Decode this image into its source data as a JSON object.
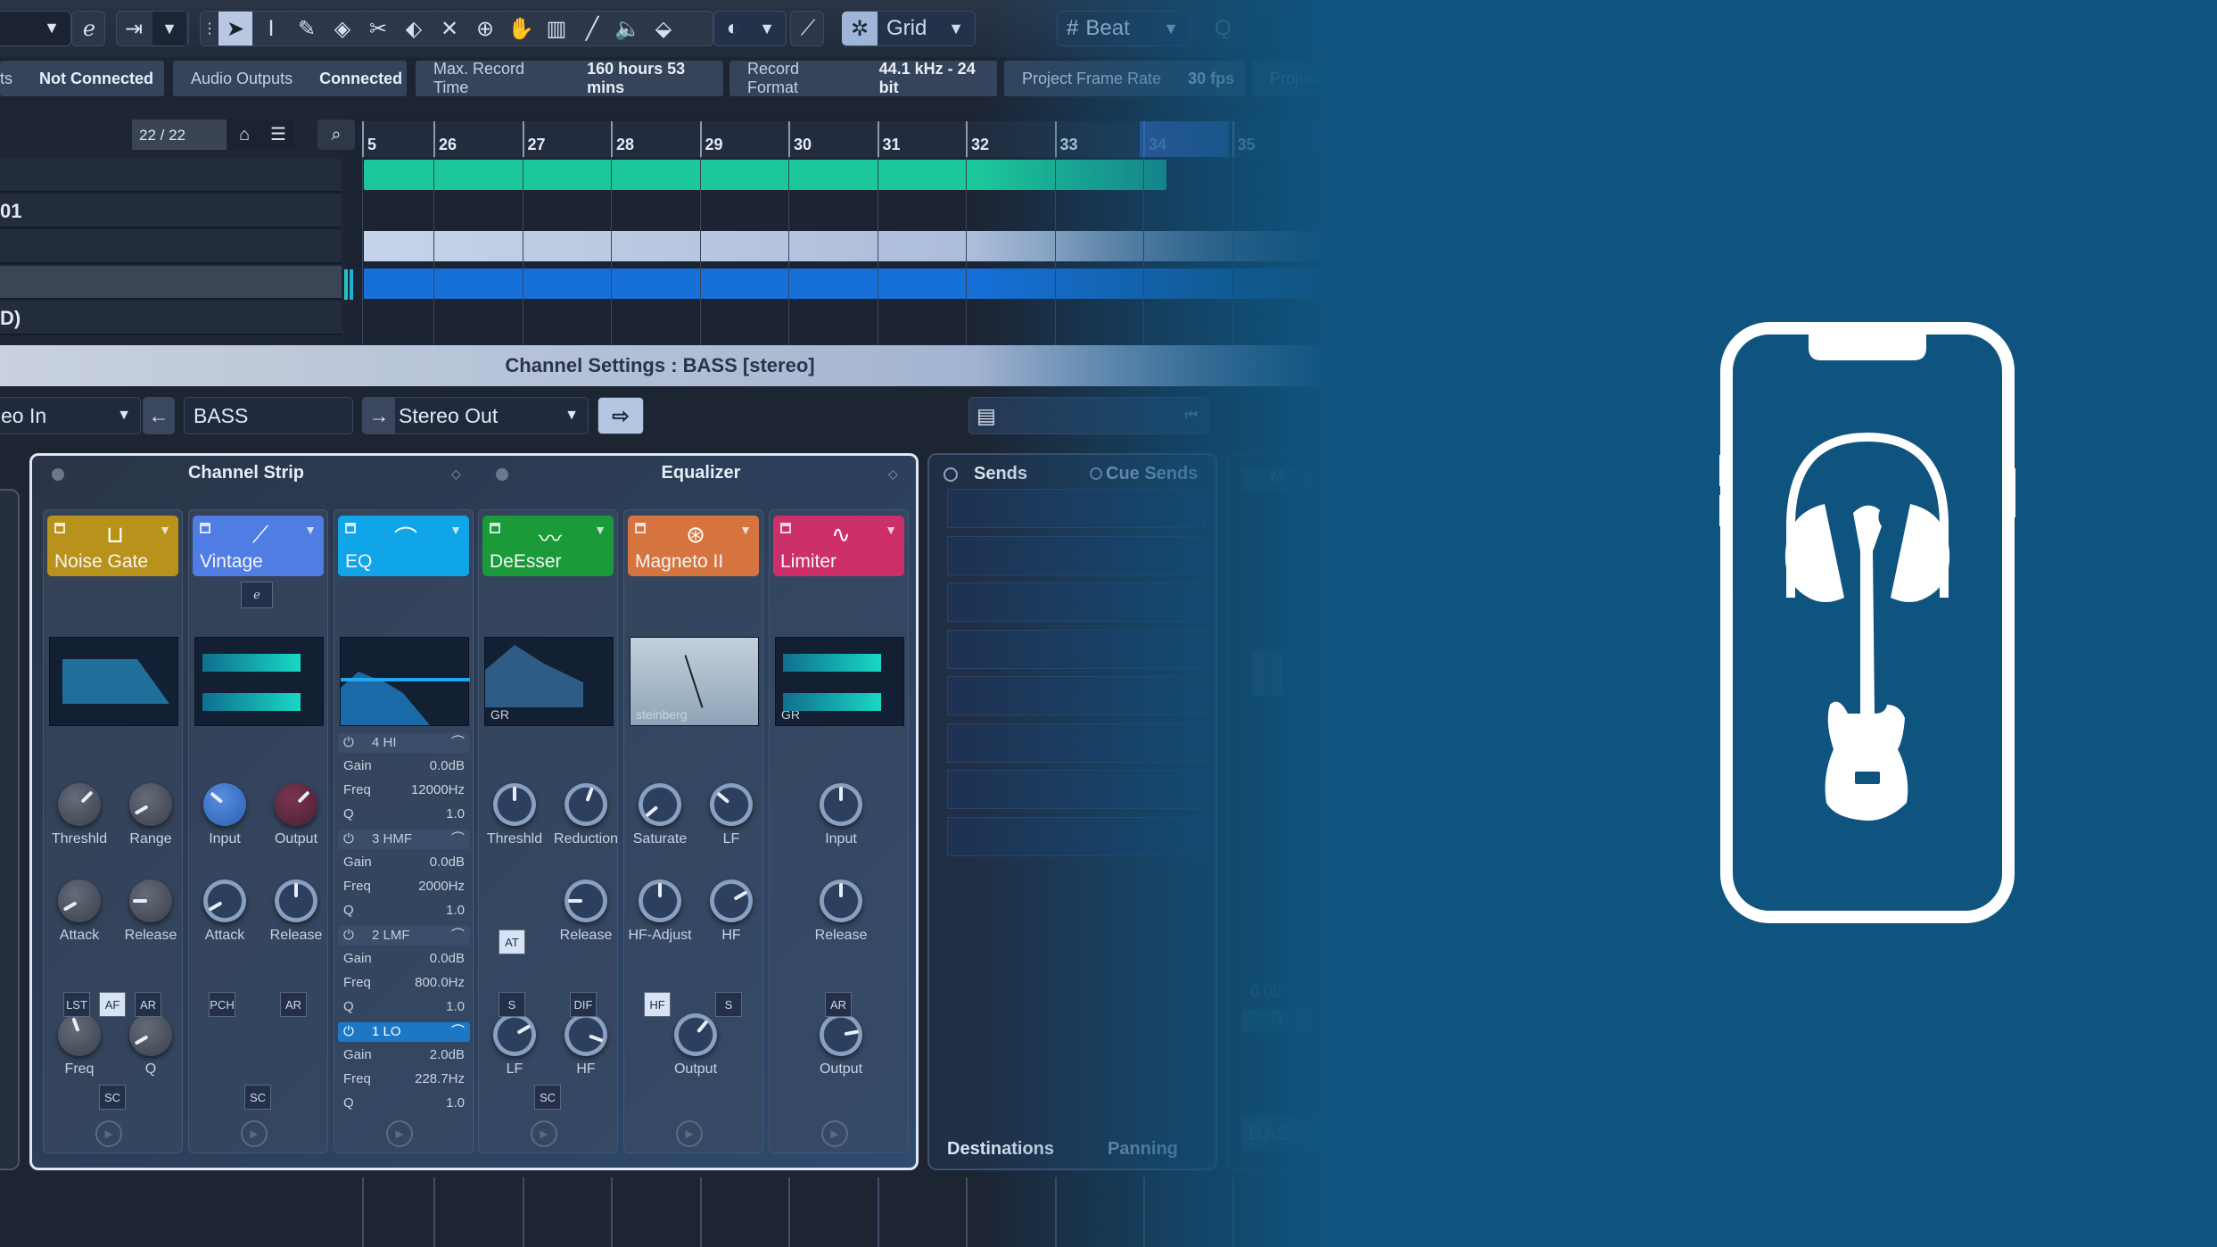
{
  "toolbar": {
    "snap_type": "Grid",
    "quantize_type": "Beat",
    "tools": [
      "object-selection",
      "range-selection",
      "draw",
      "erase",
      "split",
      "glue",
      "mute",
      "zoom",
      "play",
      "comp",
      "line",
      "speaker",
      "color"
    ]
  },
  "status": [
    {
      "key": "ts",
      "value": "Not Connected"
    },
    {
      "key": "Audio Outputs",
      "value": "Connected"
    },
    {
      "key": "Max. Record Time",
      "value": "160 hours 53 mins"
    },
    {
      "key": "Record Format",
      "value": "44.1 kHz - 24 bit"
    },
    {
      "key": "Project Frame Rate",
      "value": "30 fps"
    },
    {
      "key": "Project P",
      "value": ""
    }
  ],
  "tracklist": {
    "counter": "22 / 22",
    "tracks": [
      "",
      "01",
      "",
      "",
      "D)"
    ]
  },
  "ruler": [
    "5",
    "26",
    "27",
    "28",
    "29",
    "30",
    "31",
    "32",
    "33",
    "34",
    "35"
  ],
  "channel": {
    "title": "Channel Settings : BASS [stereo]",
    "input": "eo In",
    "name": "BASS",
    "output": "Stereo Out"
  },
  "strip": {
    "tab_channel_strip": "Channel Strip",
    "tab_equalizer": "Equalizer",
    "modules": [
      {
        "name": "Noise Gate",
        "color": "#b8921b",
        "knobs": [
          {
            "label": "Threshld",
            "rot": 45
          },
          {
            "label": "Range",
            "rot": -120
          },
          {
            "label": "Attack",
            "rot": -120
          },
          {
            "label": "Release",
            "rot": -90
          },
          {
            "label": "Freq",
            "rot": -20
          },
          {
            "label": "Q",
            "rot": -120
          }
        ],
        "buttons": [
          "LST",
          "AF",
          "AR"
        ],
        "active_button": "AF",
        "sc": "SC"
      },
      {
        "name": "Vintage",
        "color": "#4f7de3",
        "knobs": [
          {
            "label": "Input",
            "rot": -50
          },
          {
            "label": "Output",
            "rot": 45
          },
          {
            "label": "Attack",
            "rot": -120
          },
          {
            "label": "Release",
            "rot": 0
          }
        ],
        "buttons": [
          "PCH",
          "AR"
        ],
        "sc": "SC"
      },
      {
        "name": "EQ",
        "color": "#10a4e8",
        "bands": [
          {
            "name": "4 HI",
            "gain": "0.0dB",
            "freq": "12000Hz",
            "q": "1.0"
          },
          {
            "name": "3 HMF",
            "gain": "0.0dB",
            "freq": "2000Hz",
            "q": "1.0"
          },
          {
            "name": "2 LMF",
            "gain": "0.0dB",
            "freq": "800.0Hz",
            "q": "1.0"
          },
          {
            "name": "1 LO",
            "gain": "2.0dB",
            "freq": "228.7Hz",
            "q": "1.0"
          }
        ],
        "labels": {
          "gain": "Gain",
          "freq": "Freq",
          "q": "Q"
        }
      },
      {
        "name": "DeEsser",
        "color": "#1b9a3a",
        "knobs": [
          {
            "label": "Threshld",
            "rot": 0
          },
          {
            "label": "Reduction",
            "rot": 20
          },
          {
            "label": "Release",
            "rot": -90
          },
          {
            "label": "LF",
            "rot": 60
          },
          {
            "label": "HF",
            "rot": 110
          }
        ],
        "buttons": [
          "AT",
          "S",
          "DIF"
        ],
        "active_button": "AT",
        "sc": "SC",
        "display_label": "GR"
      },
      {
        "name": "Magneto II",
        "color": "#d6743f",
        "knobs": [
          {
            "label": "Saturate",
            "rot": -130
          },
          {
            "label": "LF",
            "rot": -50
          },
          {
            "label": "HF-Adjust",
            "rot": 0
          },
          {
            "label": "HF",
            "rot": 60
          },
          {
            "label": "Output",
            "rot": 40
          }
        ],
        "buttons": [
          "HF",
          "S"
        ],
        "active_button": "HF",
        "display_label": "steinberg"
      },
      {
        "name": "Limiter",
        "color": "#cc2f6a",
        "knobs": [
          {
            "label": "Input",
            "rot": 0
          },
          {
            "label": "Release",
            "rot": 0
          },
          {
            "label": "Output",
            "rot": 80
          }
        ],
        "buttons": [
          "AR"
        ],
        "display_label": "GR"
      }
    ]
  },
  "sends": {
    "tab_sends": "Sends",
    "tab_cue_sends": "Cue Sends",
    "tab_destinations": "Destinations",
    "tab_panning": "Panning",
    "slots": 8
  },
  "fader": {
    "value": "0.00",
    "name": "BASS",
    "mute": "M",
    "read": "R"
  },
  "colors": {
    "background": "#0f547f",
    "accent": "#1c77c4"
  }
}
